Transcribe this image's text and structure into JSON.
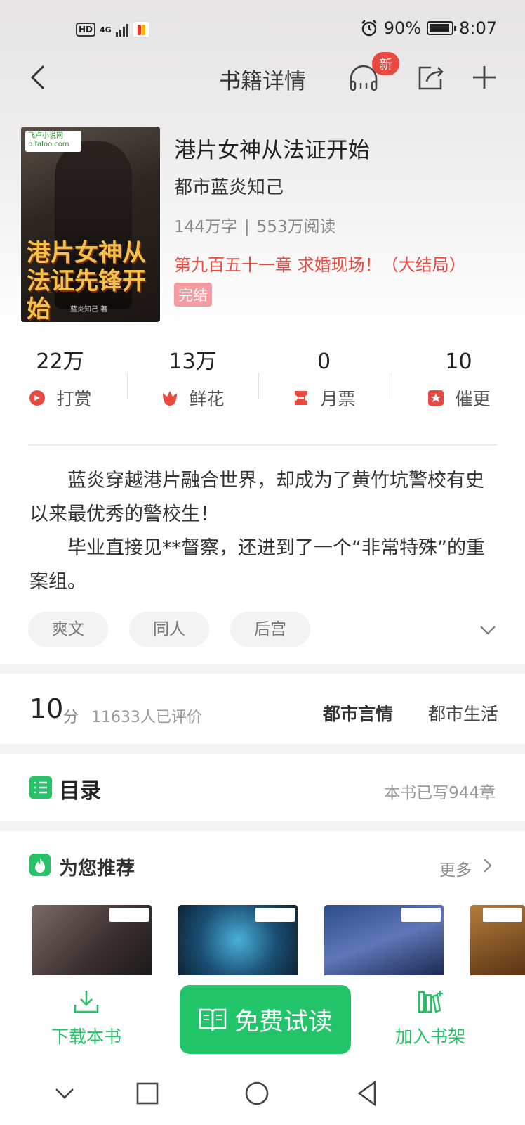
{
  "status_bar": {
    "hd": "HD",
    "network": "4G",
    "battery_percent": "90%",
    "time": "8:07"
  },
  "nav": {
    "title": "书籍详情",
    "new_badge": "新",
    "icons": [
      "back-icon",
      "listen-icon",
      "share-icon",
      "add-icon"
    ]
  },
  "book": {
    "cover_logo": "飞卢小说网 b.faloo.com",
    "cover_title": "港片女神从法证先锋开始",
    "cover_author": "蓝炎知己 著",
    "title": "港片女神从法证开始",
    "author": "都市蓝炎知己",
    "word_count": "144万字",
    "separator": "|",
    "reads": "553万阅读",
    "latest_chapter": "第九百五十一章 求婚现场！（大结局）",
    "status": "完结"
  },
  "stats": [
    {
      "value": "22万",
      "label": "打赏",
      "icon": "reward-icon"
    },
    {
      "value": "13万",
      "label": "鲜花",
      "icon": "flower-icon"
    },
    {
      "value": "0",
      "label": "月票",
      "icon": "ticket-icon"
    },
    {
      "value": "10",
      "label": "催更",
      "icon": "urge-icon"
    }
  ],
  "description": {
    "p1": "蓝炎穿越港片融合世界，却成为了黄竹坑警校有史以来最优秀的警校生！",
    "p2": "毕业直接见**督察，还进到了一个“非常特殊”的重案组。"
  },
  "tags": [
    "爽文",
    "同人",
    "后宫"
  ],
  "rating": {
    "score": "10",
    "unit": "分",
    "rated_count": "11633人已评价",
    "category_primary": "都市言情",
    "category_secondary": "都市生活"
  },
  "catalog": {
    "title": "目录",
    "count": "本书已写944章"
  },
  "recommend": {
    "title": "为您推荐",
    "more": "更多"
  },
  "bottom_bar": {
    "download": "下载本书",
    "read": "免费试读",
    "add_shelf": "加入书架"
  },
  "colors": {
    "accent_green": "#22c46a",
    "accent_red": "#e94a3f",
    "tag_pink": "#f59ca2"
  }
}
